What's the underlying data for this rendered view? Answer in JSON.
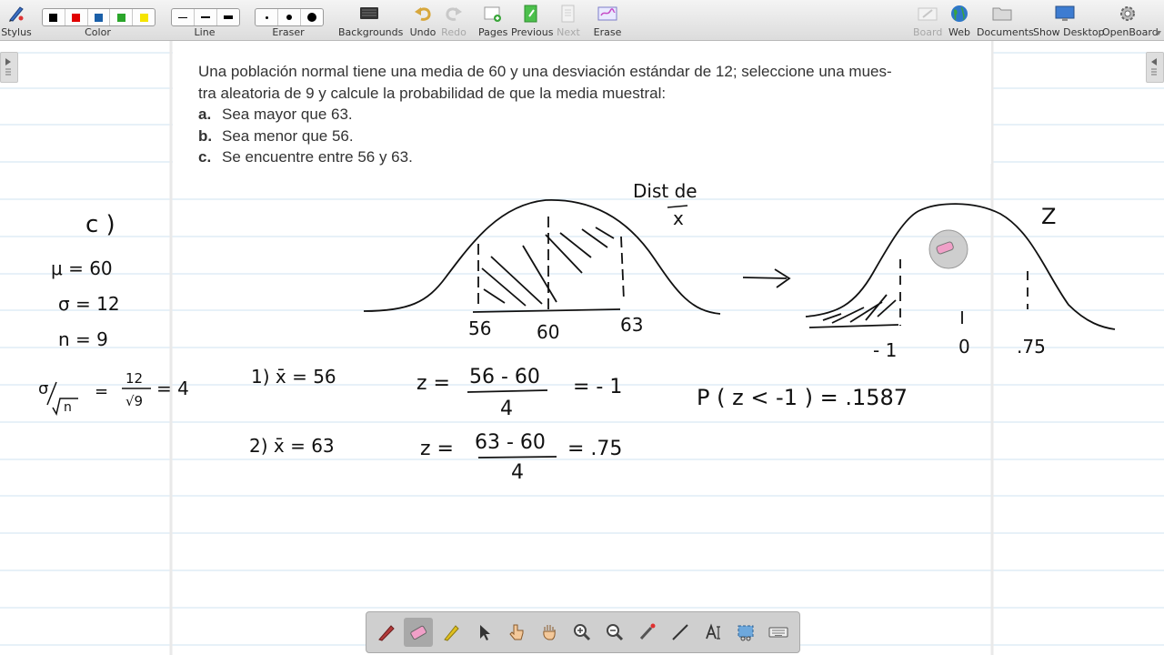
{
  "toolbar": {
    "stylus": "Stylus",
    "color": "Color",
    "line": "Line",
    "eraser": "Eraser",
    "backgrounds": "Backgrounds",
    "undo": "Undo",
    "redo": "Redo",
    "pages": "Pages",
    "previous": "Previous",
    "next": "Next",
    "erase": "Erase",
    "board": "Board",
    "web": "Web",
    "documents": "Documents",
    "show_desktop": "Show Desktop",
    "openboard": "OpenBoard",
    "colors": [
      "#000000",
      "#e00000",
      "#1a5fa8",
      "#2aa52a",
      "#f5e400"
    ]
  },
  "problem": {
    "intro_1": "Una población normal tiene una media de 60 y una desviación estándar de 12; seleccione una mues-",
    "intro_2": "tra aleatoria de 9 y calcule la probabilidad de que la media muestral:",
    "items": [
      {
        "letter": "a.",
        "text": "Sea mayor que 63."
      },
      {
        "letter": "b.",
        "text": "Sea menor que 56."
      },
      {
        "letter": "c.",
        "text": "Se encuentre entre 56 y 63."
      }
    ]
  },
  "handwriting": {
    "part": "c )",
    "mu": "μ = 60",
    "sigma": "σ = 12",
    "n": "n = 9",
    "se_lhs": "σ",
    "se_eq": "= 4",
    "se_frac_top": "12",
    "se_frac_bottom": "√9",
    "dist_label_1": "Dist de",
    "dist_label_2": "x",
    "curve1_ticks": [
      "56",
      "60",
      "63"
    ],
    "z_label": "Z",
    "curve2_ticks": [
      "- 1",
      "0",
      ".75"
    ],
    "step1": "1)  x̄ = 56",
    "step2": "2)  x̄ = 63",
    "z1_lhs": "z =",
    "z1_num": "56 - 60",
    "z1_den": "4",
    "z1_res": "= - 1",
    "z2_lhs": "z =",
    "z2_num": "63 - 60",
    "z2_den": "4",
    "z2_res": "= .75",
    "prob": "P ( z < -1 ) = .1587"
  },
  "dock": {
    "tools": [
      "pen-tool",
      "eraser-tool",
      "marker-tool",
      "selector-tool",
      "interact-tool",
      "hand-tool",
      "zoom-in-tool",
      "zoom-out-tool",
      "laser-pointer-tool",
      "line-tool",
      "text-tool",
      "capture-tool",
      "keyboard-tool"
    ]
  }
}
